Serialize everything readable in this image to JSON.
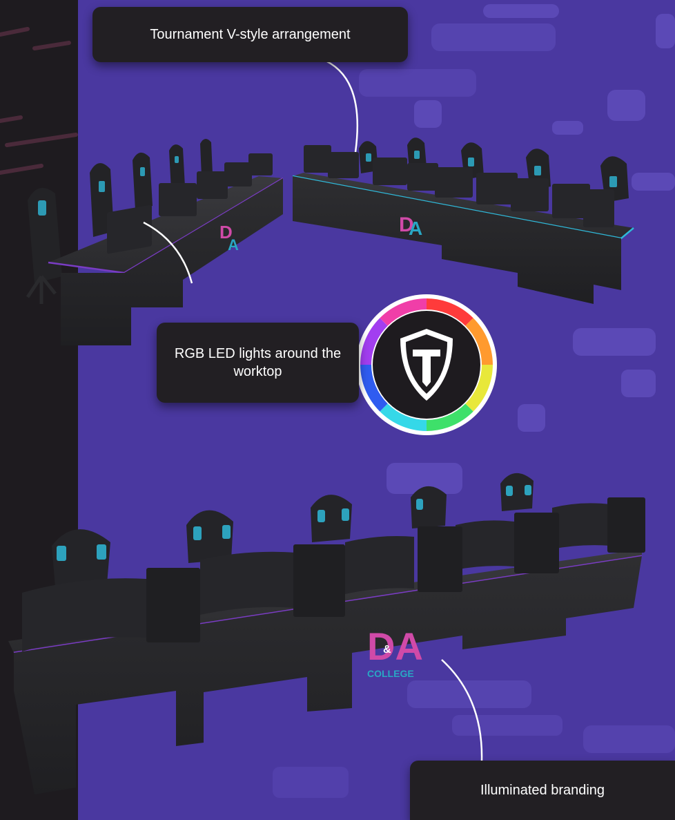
{
  "callouts": {
    "top": "Tournament V-style arrangement",
    "middle": "RGB LED lights around the worktop",
    "bottom": "Illuminated branding"
  },
  "branding": {
    "logo_main": "DA",
    "logo_small": "&",
    "logo_sub": "COLLEGE"
  },
  "colors": {
    "background_purple": "#4a38a0",
    "sidebar_dark": "#1e1b1f",
    "callout_bg": "#221f23",
    "led_purple": "#7a3cc4",
    "led_cyan": "#2fb8d8",
    "logo_pink": "#d04aa8",
    "logo_teal": "#29a7c4"
  },
  "icons": {
    "emblem": "shield-t-icon",
    "ring": "rgb-color-wheel"
  }
}
